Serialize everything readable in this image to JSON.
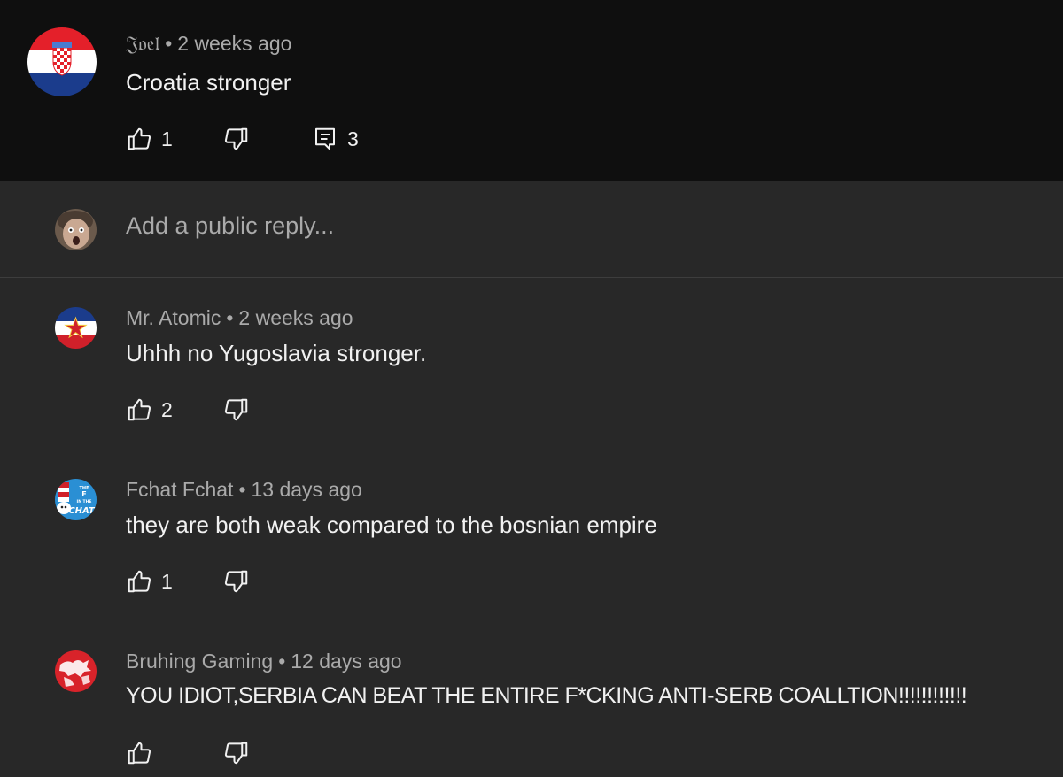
{
  "top_comment": {
    "author": "𝔍𝔬𝔢𝔩",
    "time": "2 weeks ago",
    "text": "Croatia stronger",
    "likes": "1",
    "replies_count": "3",
    "avatar_icon": "croatia-flag-icon"
  },
  "reply_input": {
    "placeholder": "Add a public reply...",
    "avatar_icon": "user-avatar-icon"
  },
  "replies": [
    {
      "author": "Mr. Atomic",
      "time": "2 weeks ago",
      "text": "Uhhh no Yugoslavia stronger.",
      "likes": "2",
      "avatar_icon": "yugoslavia-flag-icon"
    },
    {
      "author": "Fchat Fchat",
      "time": "13 days ago",
      "text": "they are both weak compared to the bosnian empire",
      "likes": "1",
      "avatar_icon": "cat-in-the-hat-icon",
      "avatar_text": [
        "THE",
        "F",
        "IN THE",
        "CHAT"
      ]
    },
    {
      "author": "Bruhing Gaming",
      "time": "12 days ago",
      "text": "YOU IDIOT,SERBIA CAN BEAT THE ENTIRE F*CKING ANTI-SERB COALLTION!!!!!!!!!!!!",
      "likes": "",
      "avatar_icon": "red-map-icon"
    }
  ],
  "colors": {
    "top_bg": "#0f0f0f",
    "panel_bg": "#282828",
    "meta_text": "#aaaaaa",
    "text": "#f1f1f1"
  },
  "icons": {
    "like": "thumb-up-icon",
    "dislike": "thumb-down-icon",
    "reply": "comment-icon"
  }
}
